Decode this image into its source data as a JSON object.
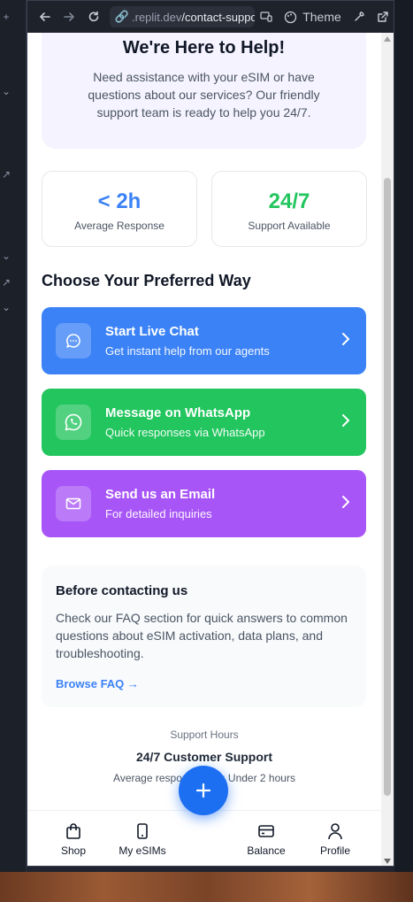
{
  "browser": {
    "url_domain": ".replit.dev",
    "url_path": "/contact-suppor",
    "theme_label": "Theme"
  },
  "hero": {
    "title": "We're Here to Help!",
    "description": "Need assistance with your eSIM or have questions about our services? Our friendly support team is ready to help you 24/7."
  },
  "stats": [
    {
      "value": "< 2h",
      "label": "Average Response",
      "color": "#3b82f6"
    },
    {
      "value": "24/7",
      "label": "Support Available",
      "color": "#22c55e"
    }
  ],
  "section_title": "Choose Your Preferred Way",
  "options": [
    {
      "title": "Start Live Chat",
      "subtitle": "Get instant help from our agents",
      "color": "#3b82f6",
      "icon": "chat-bubble-icon"
    },
    {
      "title": "Message on WhatsApp",
      "subtitle": "Quick responses via WhatsApp",
      "color": "#22c55e",
      "icon": "whatsapp-icon"
    },
    {
      "title": "Send us an Email",
      "subtitle": "For detailed inquiries",
      "color": "#a855f7",
      "icon": "mail-icon"
    }
  ],
  "faq": {
    "title": "Before contacting us",
    "text": "Check our FAQ section for quick answers to common questions about eSIM activation, data plans, and troubleshooting.",
    "link": "Browse FAQ →"
  },
  "hours": {
    "label": "Support Hours",
    "title": "24/7 Customer Support",
    "note": "Average response time: Under 2 hours"
  },
  "nav": {
    "shop": "Shop",
    "esims": "My eSIMs",
    "balance": "Balance",
    "profile": "Profile",
    "accent": "#1d6ff2"
  }
}
